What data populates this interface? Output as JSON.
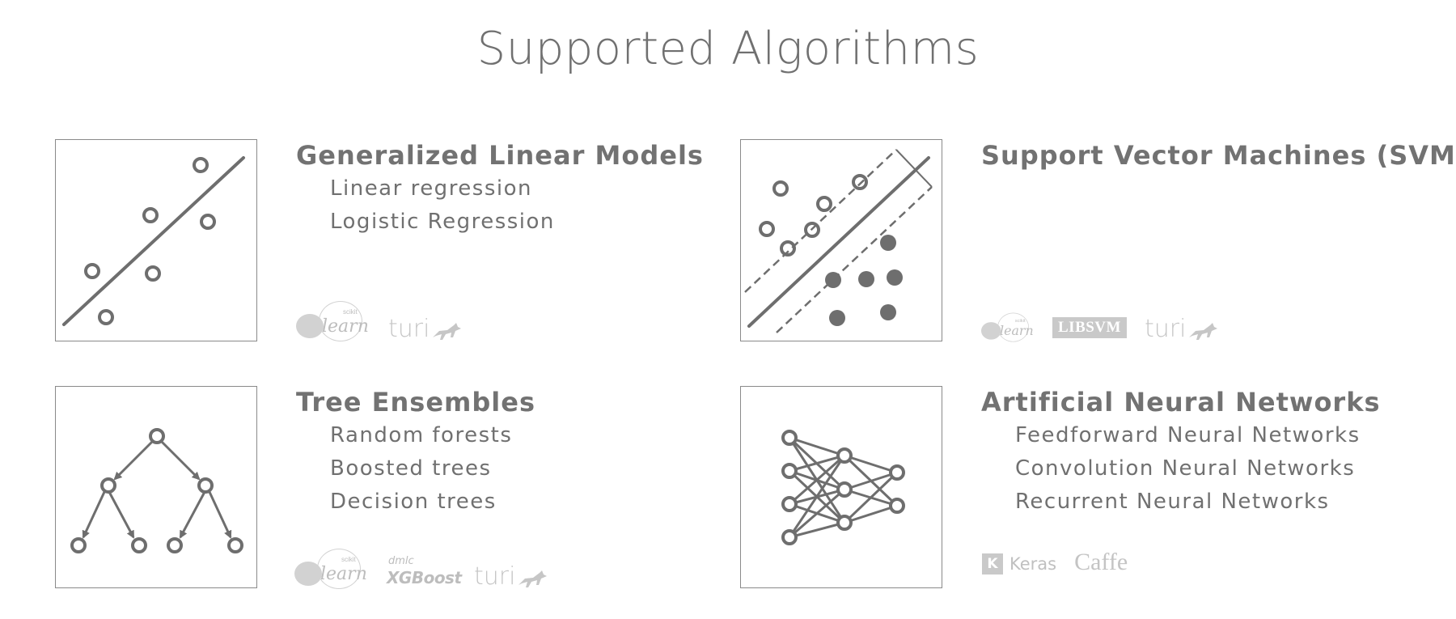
{
  "title": "Supported Algorithms",
  "sections": [
    {
      "heading": "Generalized Linear Models",
      "items": [
        "Linear regression",
        "Logistic Regression"
      ],
      "logos": [
        "scikit-learn",
        "turi"
      ]
    },
    {
      "heading": "Support Vector Machines (SVM)",
      "items": [],
      "logos": [
        "scikit-learn",
        "LIBSVM",
        "turi"
      ]
    },
    {
      "heading": "Tree Ensembles",
      "items": [
        "Random forests",
        "Boosted trees",
        "Decision trees"
      ],
      "logos": [
        "scikit-learn",
        "XGBoost",
        "turi"
      ]
    },
    {
      "heading": "Artificial Neural Networks",
      "items": [
        "Feedforward Neural Networks",
        "Convolution Neural Networks",
        "Recurrent Neural Networks"
      ],
      "logos": [
        "Keras",
        "Caffe"
      ]
    }
  ],
  "logo_text": {
    "sklearn_word": "learn",
    "sklearn_mini": "scikit",
    "turi": "turi",
    "libsvm": "LIBSVM",
    "xgboost_small": "dmlc",
    "xgboost_big": "XGBoost",
    "keras_mark": "K",
    "keras": "Keras",
    "caffe": "Caffe"
  },
  "colors": {
    "text": "#707070",
    "icon_stroke": "#6e6e6e",
    "logo_gray": "#bdbdbd"
  }
}
